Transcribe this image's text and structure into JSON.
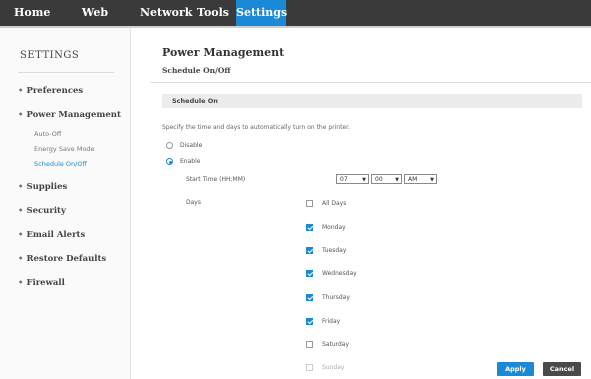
{
  "topnav": {
    "tabs": [
      {
        "label": "Home"
      },
      {
        "label": "Web Services"
      },
      {
        "label": "Network"
      },
      {
        "label": "Tools"
      },
      {
        "label": "Settings",
        "active": true
      }
    ]
  },
  "sidebar": {
    "heading": "SETTINGS",
    "items": [
      {
        "label": "Preferences"
      },
      {
        "label": "Power Management",
        "children": [
          {
            "label": "Auto-Off"
          },
          {
            "label": "Energy Save Mode"
          },
          {
            "label": "Schedule On/Off",
            "active": true
          }
        ]
      },
      {
        "label": "Supplies"
      },
      {
        "label": "Security"
      },
      {
        "label": "Email Alerts"
      },
      {
        "label": "Restore Defaults"
      },
      {
        "label": "Firewall"
      }
    ]
  },
  "main": {
    "title": "Power Management",
    "subtitle": "Schedule On/Off",
    "section_title": "Schedule On",
    "description": "Specify the time and days to automatically turn on the printer.",
    "options": {
      "disable": "Disable",
      "enable": "Enable",
      "selected": "enable"
    },
    "start_time": {
      "label": "Start Time (HH:MM)",
      "hour": "07",
      "minute": "00",
      "ampm": "AM"
    },
    "days_label": "Days",
    "days": [
      {
        "label": "All Days",
        "checked": false
      },
      {
        "label": "Monday",
        "checked": true
      },
      {
        "label": "Tuesday",
        "checked": true
      },
      {
        "label": "Wednesday",
        "checked": true
      },
      {
        "label": "Thursday",
        "checked": true
      },
      {
        "label": "Friday",
        "checked": true
      },
      {
        "label": "Saturday",
        "checked": false
      },
      {
        "label": "Sunday",
        "checked": false
      }
    ]
  },
  "actions": {
    "apply": "Apply",
    "cancel": "Cancel"
  },
  "colors": {
    "accent": "#1b8ad6",
    "topbar": "#3a3a3a",
    "cancel": "#4a4a4a"
  },
  "icons": {
    "radio": "radio-icon",
    "checkbox": "checkbox-icon",
    "dropdown": "chevron-down-icon"
  }
}
